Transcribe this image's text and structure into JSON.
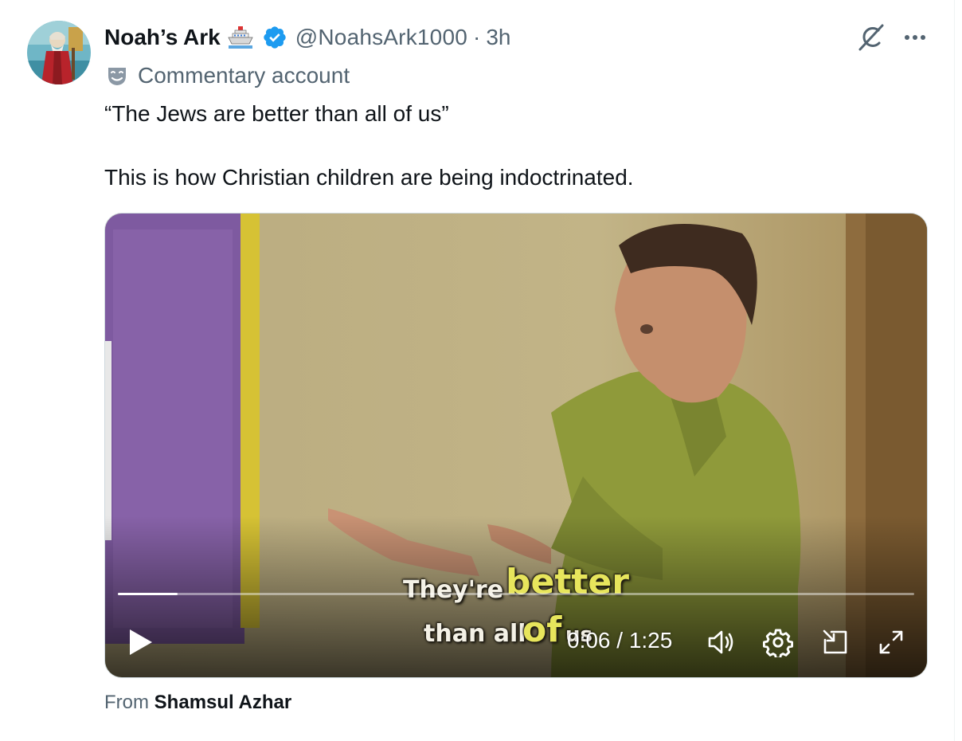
{
  "tweet": {
    "display_name": "Noah’s Ark",
    "name_emoji": "ship-icon",
    "verified_badge": "verified-badge-icon",
    "handle": "@NoahsArk1000",
    "separator": "·",
    "time": "3h",
    "label": "Commentary account",
    "label_icon": "theater-mask-icon",
    "text_line_1": "“The Jews are better than all of us”",
    "text_line_2": "This is how Christian children are being indoctrinated.",
    "actions": {
      "grok_icon": "grok-icon",
      "more_icon": "more-options-icon"
    },
    "source_prefix": "From",
    "source_name": "Shamsul Azhar"
  },
  "video": {
    "captions": {
      "a": "They're",
      "b": "better",
      "c": "than all",
      "d": "of",
      "e": "us"
    },
    "progress_fraction": 0.075,
    "current_time": "0:06",
    "time_separator": "/",
    "duration": "1:25",
    "timecode": "0:06 / 1:25",
    "controls": [
      "play-icon",
      "volume-icon",
      "settings-icon",
      "picture-in-picture-icon",
      "fullscreen-icon"
    ]
  },
  "colors": {
    "text_primary": "#0f1419",
    "text_secondary": "#536471",
    "verified_blue": "#1d9bf0",
    "caption_highlight": "#e7e55c"
  }
}
